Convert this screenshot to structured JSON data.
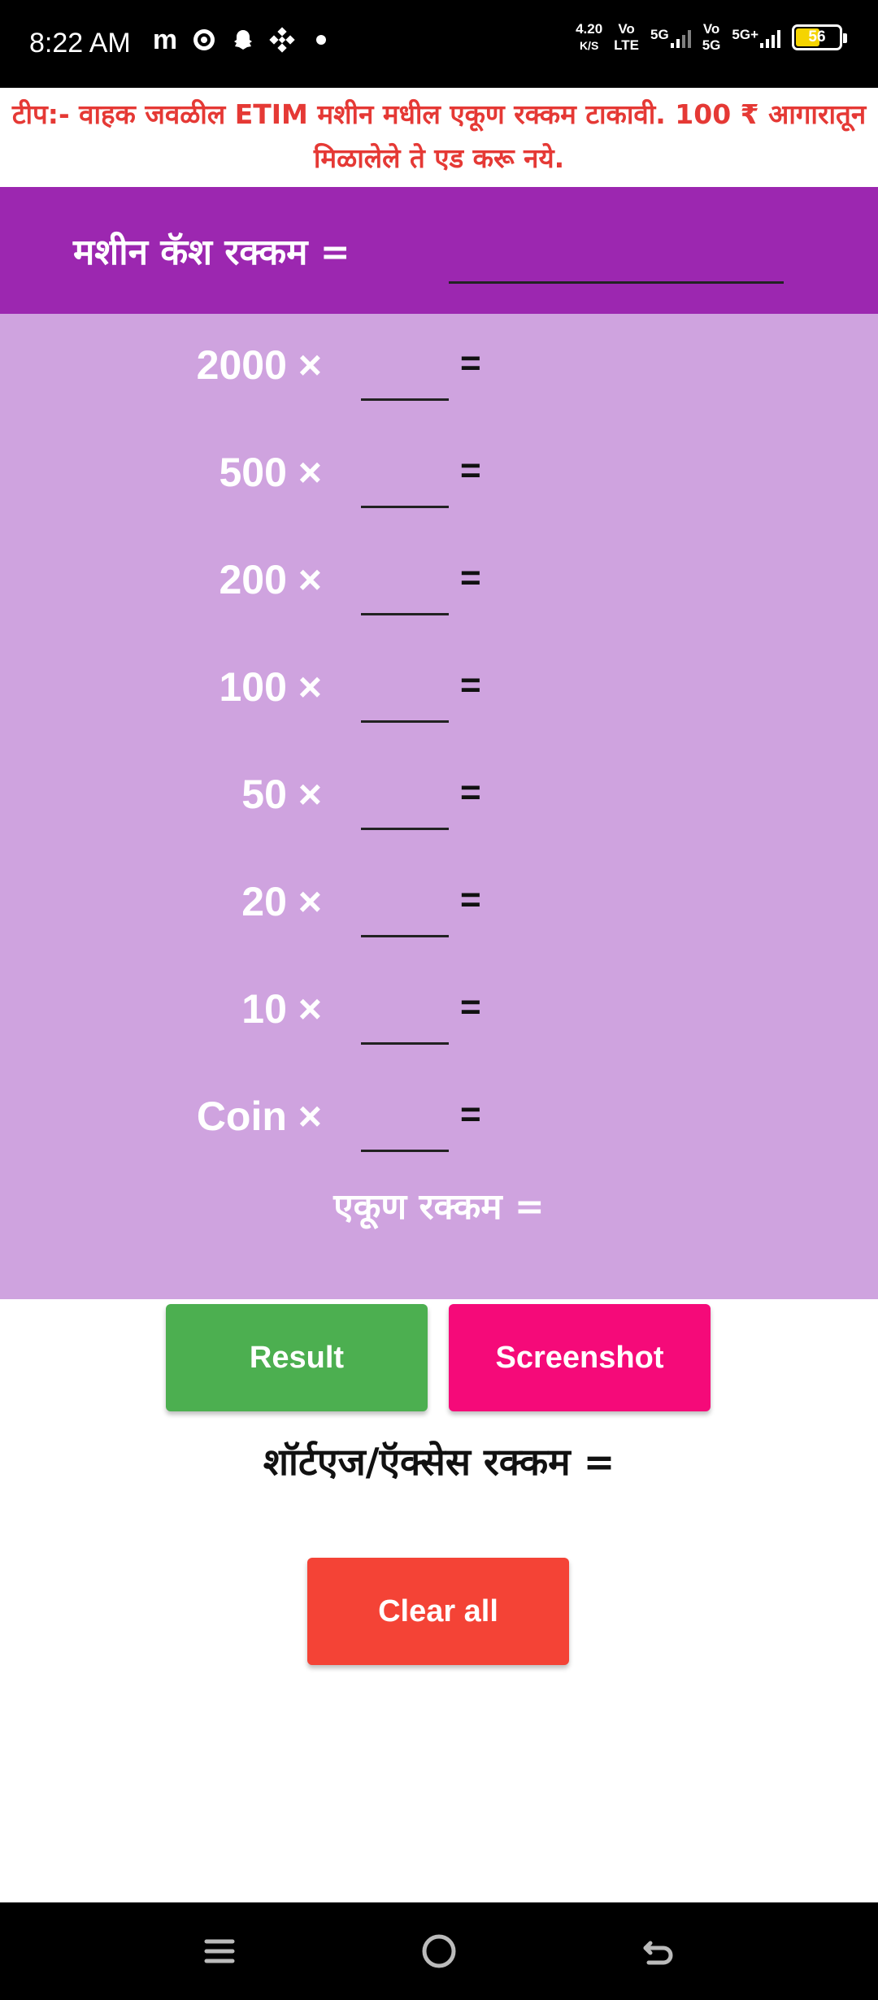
{
  "status_bar": {
    "time": "8:22 AM",
    "net_speed_value": "4.20",
    "net_speed_unit": "K/S",
    "sim1_top": "Vo",
    "sim1_bottom": "LTE",
    "sim1_net": "5G",
    "sim2_top": "Vo",
    "sim2_bottom": "5G",
    "sim2_net": "5G+",
    "battery": "56",
    "icons": [
      "m-icon",
      "whatsapp-icon",
      "snapchat-icon",
      "binance-icon",
      "dot-icon"
    ]
  },
  "tip": {
    "text": "टीप:- वाहक जवळील ETIM मशीन मधील एकूण रक्कम टाकावी. 100 ₹ आगारातून मिळालेले ते एड करू नये."
  },
  "header": {
    "label": "मशीन कॅश रक्कम =",
    "input_value": ""
  },
  "denominations": [
    {
      "label": "2000 ×",
      "value": "",
      "eq": "="
    },
    {
      "label": "500 ×",
      "value": "",
      "eq": "="
    },
    {
      "label": "200 ×",
      "value": "",
      "eq": "="
    },
    {
      "label": "100 ×",
      "value": "",
      "eq": "="
    },
    {
      "label": "50 ×",
      "value": "",
      "eq": "="
    },
    {
      "label": "20 ×",
      "value": "",
      "eq": "="
    },
    {
      "label": "10 ×",
      "value": "",
      "eq": "="
    },
    {
      "label": "Coin ×",
      "value": "",
      "eq": "="
    }
  ],
  "total_label": "एकूण रक्कम =",
  "buttons": {
    "result": "Result",
    "screenshot": "Screenshot",
    "clear": "Clear all"
  },
  "shortage_label": "शॉर्टएज/ऍक्सेस रक्कम =",
  "colors": {
    "header_bg": "#9c27b0",
    "panel_bg": "#cfa3df",
    "tip_text": "#e53935",
    "result_btn": "#4caf50",
    "screenshot_btn": "#f50a79",
    "clear_btn": "#f44336"
  },
  "nav_bar": {
    "icons": [
      "menu-icon",
      "home-icon",
      "back-icon"
    ]
  }
}
